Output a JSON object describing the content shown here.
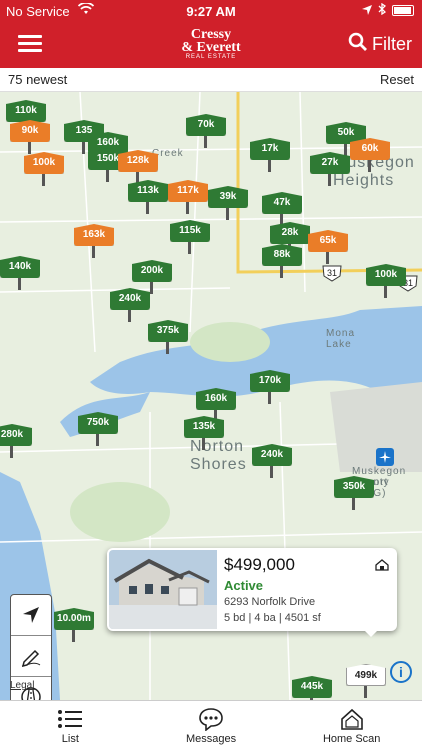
{
  "status_bar": {
    "carrier": "No Service",
    "time": "9:27 AM"
  },
  "header": {
    "logo_line1": "Cressy",
    "logo_line2": "& Everett",
    "logo_line3": "REAL ESTATE",
    "filter_label": "Filter"
  },
  "subbar": {
    "count_label": "75 newest",
    "reset_label": "Reset"
  },
  "map": {
    "places": [
      "Muskegon",
      "Heights",
      "Norton",
      "Shores",
      "Mona",
      "Lake",
      "Muskegon County",
      "Airport (MKG)",
      "Creek"
    ],
    "route_shields": [
      "31",
      "31"
    ],
    "pins": [
      {
        "label": "110k",
        "color": "green"
      },
      {
        "label": "90k",
        "color": "orange"
      },
      {
        "label": "135",
        "color": "green"
      },
      {
        "label": "160k",
        "color": "green"
      },
      {
        "label": "150k",
        "color": "green"
      },
      {
        "label": "100k",
        "color": "orange"
      },
      {
        "label": "70k",
        "color": "green"
      },
      {
        "label": "128k",
        "color": "orange"
      },
      {
        "label": "17k",
        "color": "green"
      },
      {
        "label": "50k",
        "color": "green"
      },
      {
        "label": "60k",
        "color": "orange"
      },
      {
        "label": "27k",
        "color": "green"
      },
      {
        "label": "113k",
        "color": "green"
      },
      {
        "label": "117k",
        "color": "orange"
      },
      {
        "label": "39k",
        "color": "green"
      },
      {
        "label": "47k",
        "color": "green"
      },
      {
        "label": "163k",
        "color": "orange"
      },
      {
        "label": "115k",
        "color": "green"
      },
      {
        "label": "28k",
        "color": "green"
      },
      {
        "label": "65k",
        "color": "orange"
      },
      {
        "label": "88k",
        "color": "green"
      },
      {
        "label": "140k",
        "color": "green"
      },
      {
        "label": "200k",
        "color": "green"
      },
      {
        "label": "100k",
        "color": "green"
      },
      {
        "label": "240k",
        "color": "green"
      },
      {
        "label": "375k",
        "color": "green"
      },
      {
        "label": "170k",
        "color": "green"
      },
      {
        "label": "160k",
        "color": "green"
      },
      {
        "label": "750k",
        "color": "green"
      },
      {
        "label": "135k",
        "color": "green"
      },
      {
        "label": "280k",
        "color": "green"
      },
      {
        "label": "240k",
        "color": "green"
      },
      {
        "label": "350k",
        "color": "green"
      },
      {
        "label": "10.00m",
        "color": "green"
      },
      {
        "label": "499k",
        "color": "white"
      },
      {
        "label": "445k",
        "color": "green"
      }
    ],
    "legal": "Legal"
  },
  "card": {
    "price": "$499,000",
    "status": "Active",
    "address": "6293 Norfolk Drive",
    "specs": "5 bd | 4 ba | 4501 sf"
  },
  "tabs": [
    {
      "label": "List",
      "icon": "list-icon"
    },
    {
      "label": "Messages",
      "icon": "chat-bubble-icon"
    },
    {
      "label": "Home Scan",
      "icon": "home-scan-icon"
    }
  ],
  "colors": {
    "brand_red": "#d0202a",
    "pin_green": "#2f7a34",
    "pin_orange": "#ea7d28",
    "active_green": "#2f8a34"
  }
}
